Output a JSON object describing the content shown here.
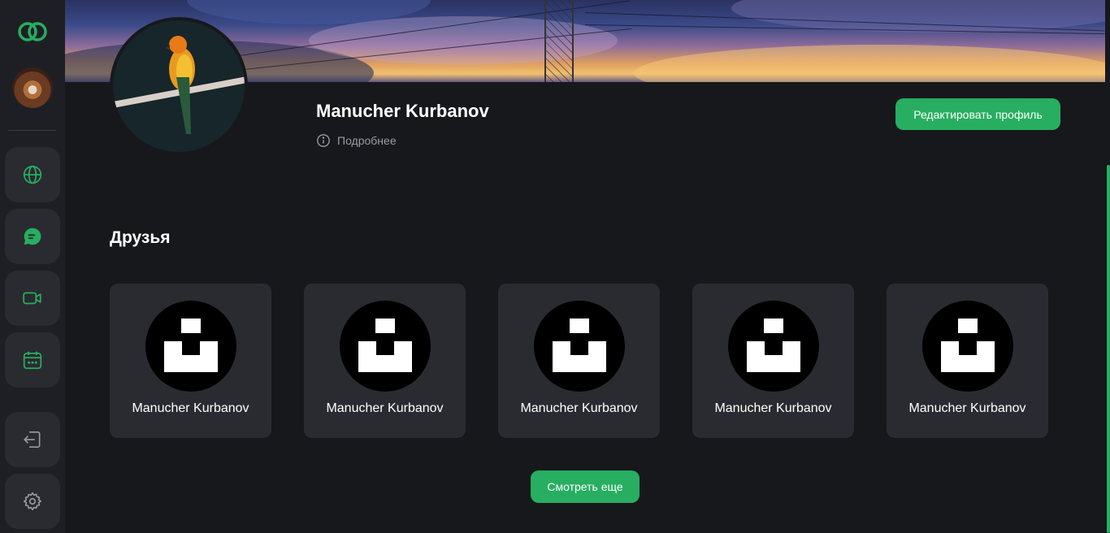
{
  "colors": {
    "accent": "#27ae60",
    "background": "#17181c",
    "sidebar": "#1e1f24",
    "card": "#2a2b31"
  },
  "sidebar": {
    "logo_icon": "linked-rings-logo",
    "items": [
      {
        "icon": "globe-icon"
      },
      {
        "icon": "chat-icon"
      },
      {
        "icon": "video-camera-icon"
      },
      {
        "icon": "calendar-icon"
      },
      {
        "icon": "logout-icon"
      },
      {
        "icon": "gear-icon"
      }
    ]
  },
  "profile": {
    "name": "Manucher Kurbanov",
    "more_label": "Подробнее",
    "edit_button": "Редактировать профиль"
  },
  "friends": {
    "title": "Друзья",
    "items": [
      {
        "name": "Manucher Kurbanov"
      },
      {
        "name": "Manucher Kurbanov"
      },
      {
        "name": "Manucher Kurbanov"
      },
      {
        "name": "Manucher Kurbanov"
      },
      {
        "name": "Manucher Kurbanov"
      }
    ],
    "see_more": "Смотреть еще"
  }
}
